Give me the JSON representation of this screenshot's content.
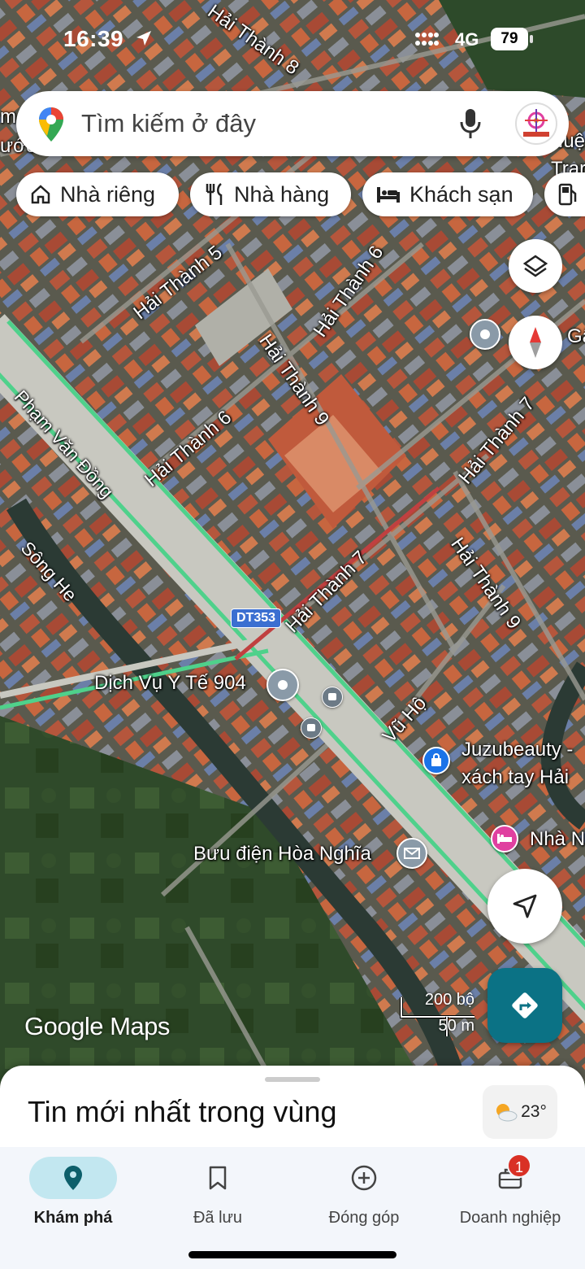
{
  "status_bar": {
    "time": "16:39",
    "network": "4G",
    "battery": "79"
  },
  "search": {
    "placeholder": "Tìm kiếm ở đây"
  },
  "chips": [
    {
      "label": "Nhà riêng",
      "icon": "home-icon"
    },
    {
      "label": "Nhà hàng",
      "icon": "restaurant-icon"
    },
    {
      "label": "Khách sạn",
      "icon": "hotel-icon"
    },
    {
      "label": "",
      "icon": "gas-station-icon"
    }
  ],
  "map": {
    "streets": [
      "Hải Thành 8",
      "Hải Thành 5",
      "Hải Thành 6",
      "Hải Thành 9",
      "Hải Thành 6",
      "Hải Thành 7",
      "Hải Thành 9",
      "Hải Thành 7",
      "Phạm Văn Đồng",
      "Sông He",
      "Vũ Hộ"
    ],
    "route_badge": "DT353",
    "places": [
      {
        "name": "Dịch Vụ Y Tế 904",
        "icon": "pin-icon"
      },
      {
        "name": "Juzubeauty -",
        "name2": "xách tay Hải",
        "icon": "shopping-bag-icon"
      },
      {
        "name": "Nhà N",
        "icon": "hotel-icon"
      },
      {
        "name": "Bưu điện Hòa Nghĩa",
        "icon": "mail-icon"
      }
    ],
    "edge_labels": {
      "left_m": "m",
      "left_uoc": "ước",
      "right_nuq": "Nuệ",
      "right_tran": "Trar",
      "right_gan": "Gâ"
    },
    "brand": "Google Maps",
    "scale": {
      "imperial": "200 bộ",
      "metric": "50 m"
    }
  },
  "sheet": {
    "title": "Tin mới nhất trong vùng",
    "temperature": "23°"
  },
  "nav": {
    "items": [
      {
        "label": "Khám phá",
        "active": true
      },
      {
        "label": "Đã lưu",
        "active": false
      },
      {
        "label": "Đóng góp",
        "active": false
      },
      {
        "label": "Doanh nghiệp",
        "active": false
      }
    ],
    "badge": "1"
  },
  "colors": {
    "road_green": "#4fd18b",
    "accent_teal": "#0b7285",
    "route_blue": "#3b6fd1"
  }
}
